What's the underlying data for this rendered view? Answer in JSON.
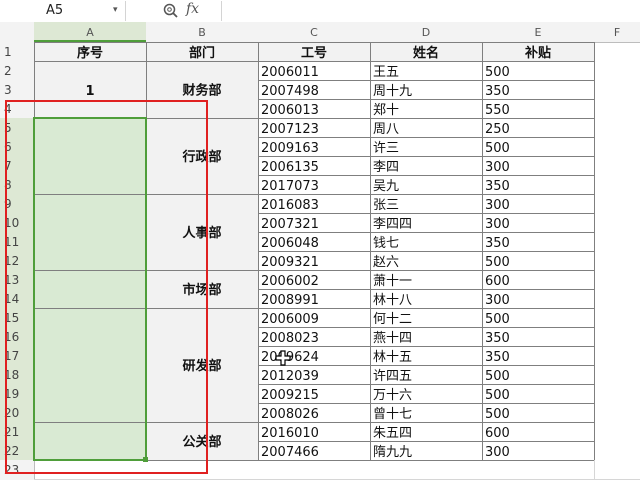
{
  "formula_bar": {
    "name_box": "A5",
    "fx_label": "fx",
    "formula": ""
  },
  "columns": [
    "A",
    "B",
    "C",
    "D",
    "E",
    "F"
  ],
  "rows": [
    "1",
    "2",
    "3",
    "4",
    "5",
    "6",
    "7",
    "8",
    "9",
    "10",
    "11",
    "12",
    "13",
    "14",
    "15",
    "16",
    "17",
    "18",
    "19",
    "20",
    "21",
    "22",
    "23"
  ],
  "table": {
    "headers": [
      "序号",
      "部门",
      "工号",
      "姓名",
      "补贴"
    ],
    "serial": "1",
    "departments": [
      "财务部",
      "行政部",
      "人事部",
      "市场部",
      "研发部",
      "公关部"
    ],
    "records": [
      [
        "2006011",
        "王五",
        "500"
      ],
      [
        "2007498",
        "周十九",
        "350"
      ],
      [
        "2006013",
        "郑十",
        "550"
      ],
      [
        "2007123",
        "周八",
        "250"
      ],
      [
        "2009163",
        "许三",
        "500"
      ],
      [
        "2006135",
        "李四",
        "300"
      ],
      [
        "2017073",
        "吴九",
        "350"
      ],
      [
        "2016083",
        "张三",
        "300"
      ],
      [
        "2007321",
        "李四四",
        "300"
      ],
      [
        "2006048",
        "钱七",
        "350"
      ],
      [
        "2009321",
        "赵六",
        "500"
      ],
      [
        "2006002",
        "萧十一",
        "600"
      ],
      [
        "2008991",
        "林十八",
        "300"
      ],
      [
        "2006009",
        "何十二",
        "500"
      ],
      [
        "2008023",
        "燕十四",
        "350"
      ],
      [
        "2009624",
        "林十五",
        "350"
      ],
      [
        "2012039",
        "许四五",
        "500"
      ],
      [
        "2009215",
        "万十六",
        "500"
      ],
      [
        "2008026",
        "曾十七",
        "500"
      ],
      [
        "2016010",
        "朱五四",
        "600"
      ],
      [
        "2007466",
        "隋九九",
        "300"
      ]
    ]
  },
  "colors": {
    "selection_fill": "#d9ead3",
    "selection_border": "#4f9e3a",
    "annotation_box": "#e02020",
    "header_bg": "#f3f3f3",
    "active_col_header_bg": "#dde8d4",
    "active_col_header_text": "#3d7e2b"
  }
}
